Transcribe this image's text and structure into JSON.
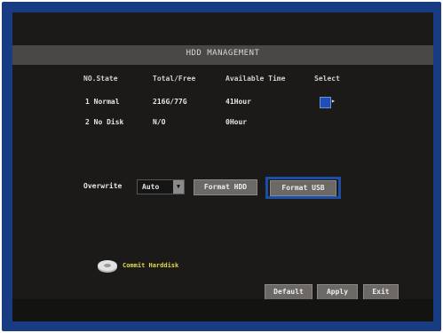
{
  "title": "HDD MANAGEMENT",
  "table": {
    "headers": [
      "NO.State",
      "Total/Free",
      "Available Time",
      "Select"
    ],
    "rows": [
      {
        "no_state": "1  Normal",
        "total_free": "216G/77G",
        "available_time": "41Hour"
      },
      {
        "no_state": "2  No Disk",
        "total_free": "N/O",
        "available_time": "0Hour"
      }
    ]
  },
  "overwrite": {
    "label": "Overwrite",
    "value": "Auto"
  },
  "buttons": {
    "format_hdd": "Format HDD",
    "format_usb": "Format USB",
    "default": "Default",
    "apply": "Apply",
    "exit": "Exit"
  },
  "status": "Commit Harddisk",
  "icons": {
    "select_arrow": "pointer-arrow-icon",
    "disk": "disk-icon"
  },
  "colors": {
    "accent": "#1a4fa8",
    "status_text": "#e0d84a"
  }
}
